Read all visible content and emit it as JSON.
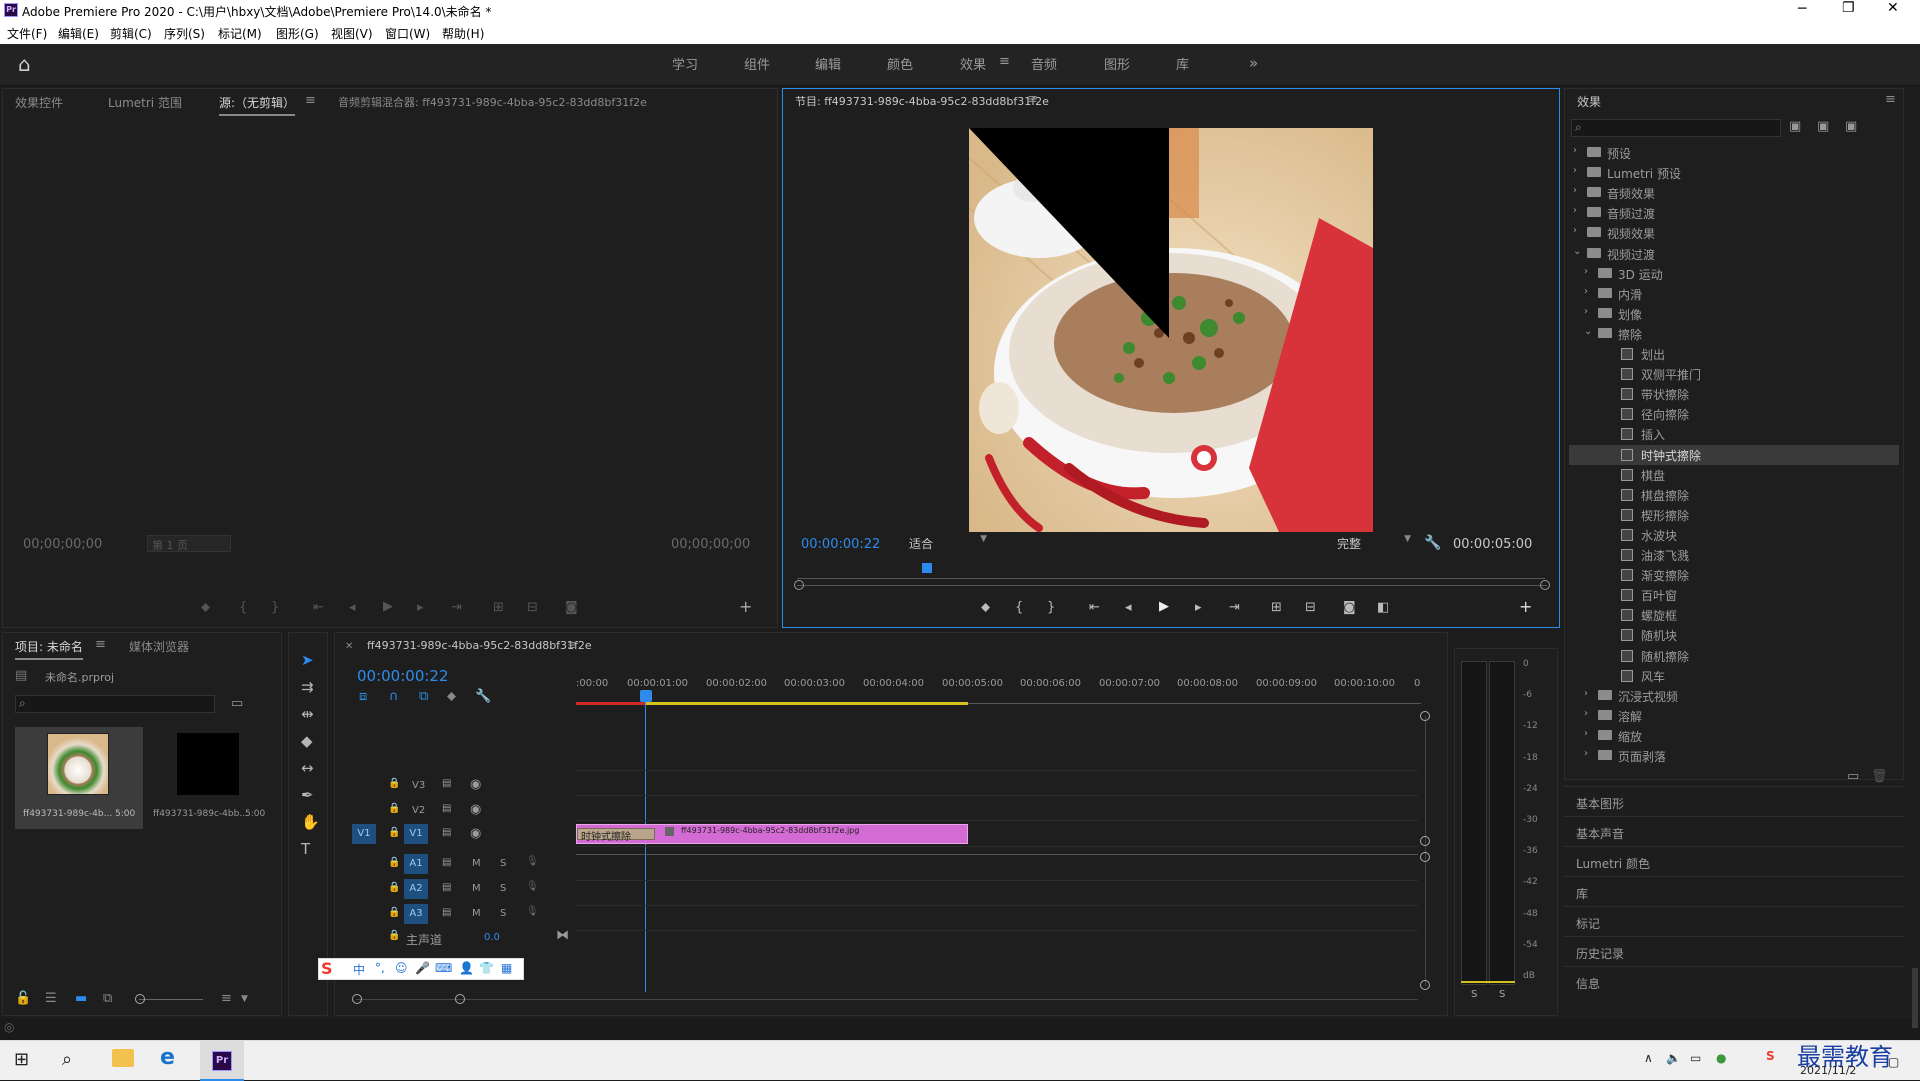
{
  "window": {
    "title": "Adobe Premiere Pro 2020 - C:\\用户\\hbxy\\文档\\Adobe\\Premiere Pro\\14.0\\未命名 *"
  },
  "menu": [
    "文件(F)",
    "编辑(E)",
    "剪辑(C)",
    "序列(S)",
    "标记(M)",
    "图形(G)",
    "视图(V)",
    "窗口(W)",
    "帮助(H)"
  ],
  "workspaces": {
    "items": [
      "学习",
      "组件",
      "编辑",
      "颜色",
      "效果",
      "音频",
      "图形",
      "库"
    ],
    "active": "效果",
    "more": "»"
  },
  "source_panel": {
    "tabs": [
      "效果控件",
      "Lumetri 范围",
      "源:（无剪辑）",
      "音频剪辑混合器: ff493731-989c-4bba-95c2-83dd8bf31f2e"
    ],
    "timecode_left": "00;00;00;00",
    "timecode_right": "00;00;00;00",
    "page": "第 1 页"
  },
  "program_panel": {
    "title": "节目: ff493731-989c-4bba-95c2-83dd8bf31f2e",
    "timecode": "00:00:00:22",
    "fit": "适合",
    "quality": "完整",
    "duration": "00:00:05:00"
  },
  "effects_panel": {
    "title": "效果",
    "tree": [
      {
        "label": "预设",
        "level": 0,
        "type": "folder",
        "state": "closed"
      },
      {
        "label": "Lumetri 预设",
        "level": 0,
        "type": "folder",
        "state": "closed"
      },
      {
        "label": "音频效果",
        "level": 0,
        "type": "folder",
        "state": "closed"
      },
      {
        "label": "音频过渡",
        "level": 0,
        "type": "folder",
        "state": "closed"
      },
      {
        "label": "视频效果",
        "level": 0,
        "type": "folder",
        "state": "closed"
      },
      {
        "label": "视频过渡",
        "level": 0,
        "type": "folder",
        "state": "open"
      },
      {
        "label": "3D 运动",
        "level": 1,
        "type": "folder",
        "state": "closed"
      },
      {
        "label": "内滑",
        "level": 1,
        "type": "folder",
        "state": "closed"
      },
      {
        "label": "划像",
        "level": 1,
        "type": "folder",
        "state": "closed"
      },
      {
        "label": "擦除",
        "level": 1,
        "type": "folder",
        "state": "open"
      },
      {
        "label": "划出",
        "level": 2,
        "type": "fx"
      },
      {
        "label": "双侧平推门",
        "level": 2,
        "type": "fx"
      },
      {
        "label": "带状擦除",
        "level": 2,
        "type": "fx"
      },
      {
        "label": "径向擦除",
        "level": 2,
        "type": "fx"
      },
      {
        "label": "插入",
        "level": 2,
        "type": "fx"
      },
      {
        "label": "时钟式擦除",
        "level": 2,
        "type": "fx",
        "selected": true
      },
      {
        "label": "棋盘",
        "level": 2,
        "type": "fx"
      },
      {
        "label": "棋盘擦除",
        "level": 2,
        "type": "fx"
      },
      {
        "label": "楔形擦除",
        "level": 2,
        "type": "fx"
      },
      {
        "label": "水波块",
        "level": 2,
        "type": "fx"
      },
      {
        "label": "油漆飞溅",
        "level": 2,
        "type": "fx"
      },
      {
        "label": "渐变擦除",
        "level": 2,
        "type": "fx"
      },
      {
        "label": "百叶窗",
        "level": 2,
        "type": "fx"
      },
      {
        "label": "螺旋框",
        "level": 2,
        "type": "fx"
      },
      {
        "label": "随机块",
        "level": 2,
        "type": "fx"
      },
      {
        "label": "随机擦除",
        "level": 2,
        "type": "fx"
      },
      {
        "label": "风车",
        "level": 2,
        "type": "fx"
      },
      {
        "label": "沉浸式视频",
        "level": 1,
        "type": "folder",
        "state": "closed"
      },
      {
        "label": "溶解",
        "level": 1,
        "type": "folder",
        "state": "closed"
      },
      {
        "label": "缩放",
        "level": 1,
        "type": "folder",
        "state": "closed"
      },
      {
        "label": "页面剥落",
        "level": 1,
        "type": "folder",
        "state": "closed"
      }
    ],
    "sections": [
      "基本图形",
      "基本声音",
      "Lumetri 颜色",
      "库",
      "标记",
      "历史记录",
      "信息"
    ]
  },
  "project_panel": {
    "tabs": [
      "项目: 未命名",
      "媒体浏览器"
    ],
    "file": "未命名.prproj",
    "items": [
      {
        "name": "ff493731-989c-4b...",
        "duration": "5:00"
      },
      {
        "name": "ff493731-989c-4bb...",
        "duration": "5:00"
      }
    ]
  },
  "timeline": {
    "tab": "ff493731-989c-4bba-95c2-83dd8bf31f2e",
    "timecode": "00:00:00:22",
    "ruler": [
      ":00:00",
      "00:00:01:00",
      "00:00:02:00",
      "00:00:03:00",
      "00:00:04:00",
      "00:00:05:00",
      "00:00:06:00",
      "00:00:07:00",
      "00:00:08:00",
      "00:00:09:00",
      "00:00:10:00",
      "0"
    ],
    "video_tracks": [
      "V3",
      "V2",
      "V1"
    ],
    "audio_tracks": [
      "A1",
      "A2",
      "A3"
    ],
    "source_patch": "V1",
    "master": {
      "label": "主声道",
      "value": "0.0"
    },
    "clip": {
      "name": "ff493731-989c-4bba-95c2-83dd8bf31f2e.jpg",
      "transition": "时钟式擦除"
    }
  },
  "audio_meter": {
    "scale": [
      "0",
      "-6",
      "-12",
      "-18",
      "-24",
      "-30",
      "-36",
      "-42",
      "-48",
      "-54",
      "dB"
    ],
    "solo": [
      "S",
      "S"
    ]
  },
  "taskbar": {
    "date": "2021/11/2",
    "watermark": "最需教育"
  }
}
